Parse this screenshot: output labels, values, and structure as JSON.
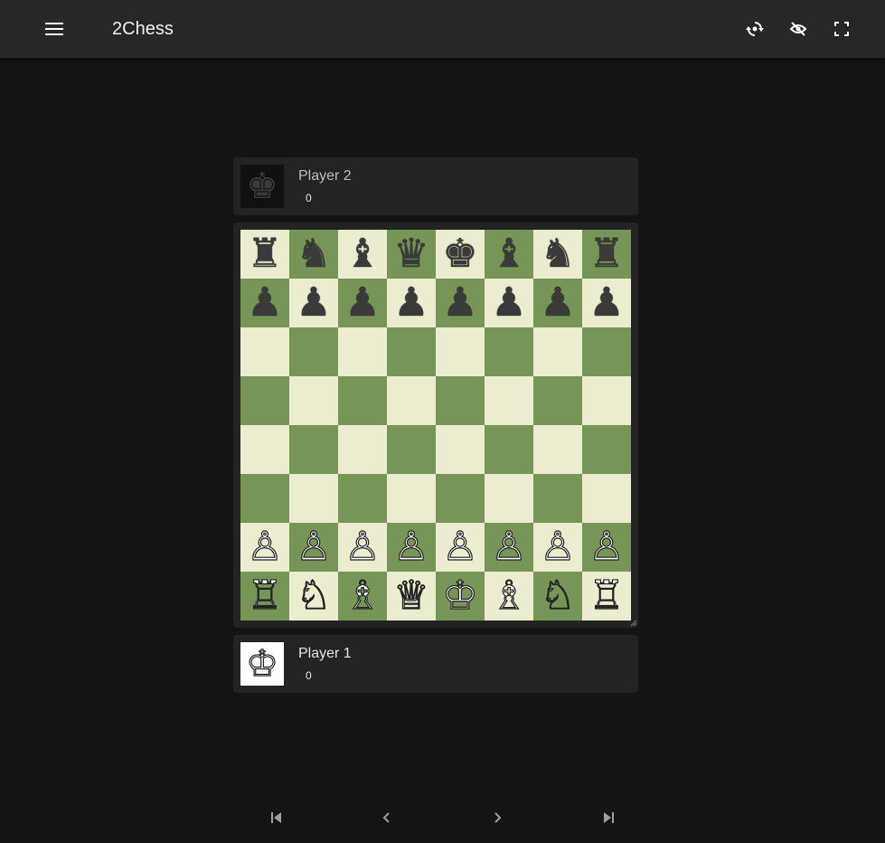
{
  "app": {
    "title": "2Chess"
  },
  "toolbar": {
    "menu_icon": "menu-icon",
    "icons": [
      "flip-board-icon",
      "hide-eye-icon",
      "fullscreen-icon"
    ]
  },
  "players": {
    "top": {
      "name": "Player 2",
      "score": "0",
      "avatar": "black-king-icon"
    },
    "bottom": {
      "name": "Player 1",
      "score": "0",
      "avatar": "white-king-icon"
    }
  },
  "board": {
    "colors": {
      "light": "#ebecd0",
      "dark": "#779556"
    },
    "position": [
      [
        "bR",
        "bN",
        "bB",
        "bQ",
        "bK",
        "bB",
        "bN",
        "bR"
      ],
      [
        "bP",
        "bP",
        "bP",
        "bP",
        "bP",
        "bP",
        "bP",
        "bP"
      ],
      [
        "",
        "",
        "",
        "",
        "",
        "",
        "",
        ""
      ],
      [
        "",
        "",
        "",
        "",
        "",
        "",
        "",
        ""
      ],
      [
        "",
        "",
        "",
        "",
        "",
        "",
        "",
        ""
      ],
      [
        "",
        "",
        "",
        "",
        "",
        "",
        "",
        ""
      ],
      [
        "wP",
        "wP",
        "wP",
        "wP",
        "wP",
        "wP",
        "wP",
        "wP"
      ],
      [
        "wR",
        "wN",
        "wB",
        "wQ",
        "wK",
        "wB",
        "wN",
        "wR"
      ]
    ]
  },
  "navigation": {
    "icons": [
      "first-move-icon",
      "previous-move-icon",
      "next-move-icon",
      "last-move-icon"
    ]
  }
}
